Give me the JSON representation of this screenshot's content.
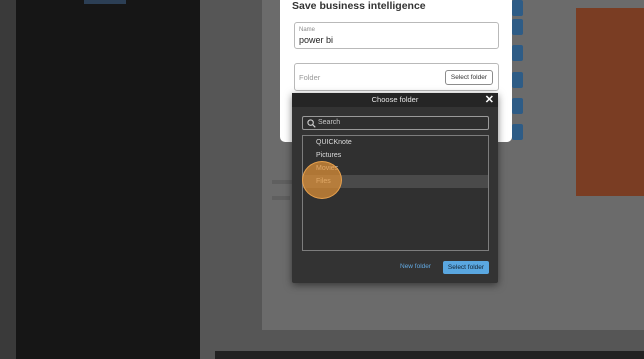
{
  "save_dialog": {
    "title": "Save business intelligence",
    "name_field": {
      "label": "Name",
      "value": "power bi"
    },
    "folder_field": {
      "label": "Folder",
      "button_label": "Select folder"
    }
  },
  "folder_chooser": {
    "title": "Choose folder",
    "close_icon": "close-icon",
    "search": {
      "placeholder": "Search"
    },
    "folders": [
      {
        "label": "QUICKnote",
        "selected": false
      },
      {
        "label": "Pictures",
        "selected": false
      },
      {
        "label": "Movies",
        "selected": false
      },
      {
        "label": "Files",
        "selected": true
      }
    ],
    "new_folder_label": "New folder",
    "select_button_label": "Select folder"
  },
  "colors": {
    "accent": "#5aa7e0",
    "link": "#62a8e0",
    "click_indicator": "#e9a24e",
    "modal_bg": "#333333"
  }
}
